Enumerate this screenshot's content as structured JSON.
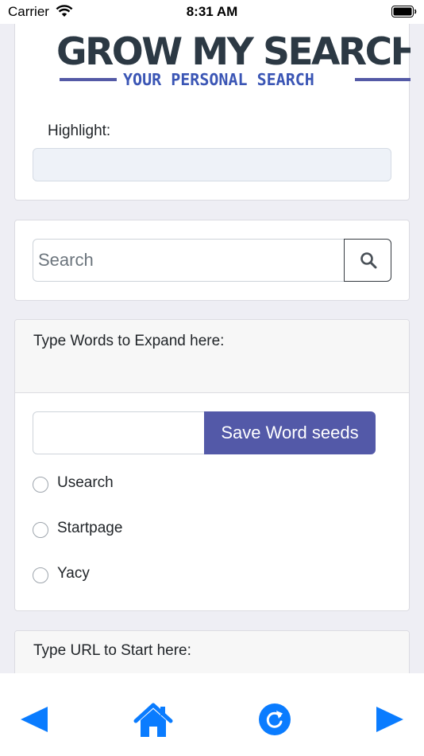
{
  "status_bar": {
    "carrier": "Carrier",
    "time": "8:31 AM"
  },
  "logo": {
    "title": "GROW MY SEARCH",
    "subtitle": "YOUR PERSONAL SEARCH"
  },
  "highlight": {
    "label": "Highlight:",
    "value": ""
  },
  "search": {
    "placeholder": "Search",
    "value": ""
  },
  "expand": {
    "title": "Type Words to Expand here:",
    "input_value": "",
    "save_label": "Save Word seeds",
    "engines": [
      {
        "label": "Usearch",
        "selected": false
      },
      {
        "label": "Startpage",
        "selected": false
      },
      {
        "label": "Yacy",
        "selected": false
      }
    ]
  },
  "url_section": {
    "title": "Type URL to Start here:"
  },
  "toolbar": {
    "icons": [
      "back-arrow-icon",
      "home-icon",
      "refresh-icon",
      "forward-arrow-icon"
    ],
    "accent_color": "#0a7cff"
  },
  "colors": {
    "primary_button": "#5359a8",
    "logo_dark": "#2c3944",
    "logo_blue": "#3b56b5",
    "background": "#eeeef4"
  }
}
